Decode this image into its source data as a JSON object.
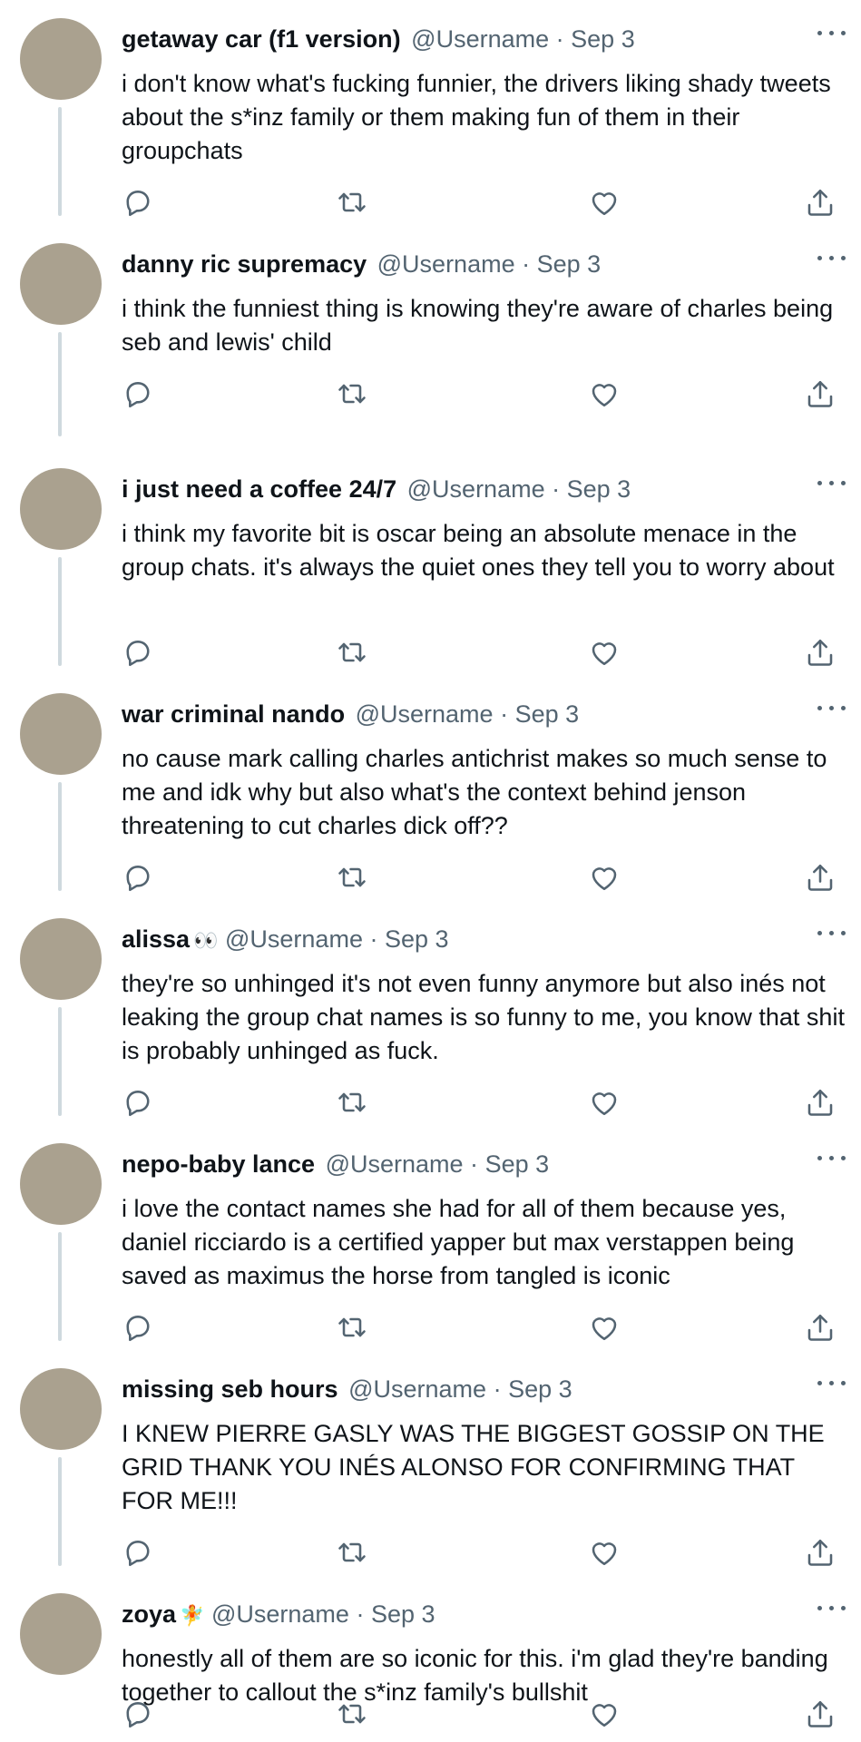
{
  "tweets": [
    {
      "name": "getaway car (f1 version)",
      "emoji": "",
      "handle": "@Username",
      "sep": "·",
      "date": "Sep 3",
      "text": "i don't know what's fucking funnier, the drivers liking shady tweets about the s*inz family or them making fun of them in their groupchats"
    },
    {
      "name": "danny ric supremacy",
      "emoji": "",
      "handle": "@Username",
      "sep": "·",
      "date": "Sep 3",
      "text": "i think the funniest thing is knowing they're aware of charles being seb and lewis' child"
    },
    {
      "name": "i just need a coffee 24/7",
      "emoji": "",
      "handle": "@Username",
      "sep": "·",
      "date": "Sep 3",
      "text": "i think my favorite bit is oscar being an absolute menace in the group chats. it's always the quiet ones they tell you to worry about"
    },
    {
      "name": "war criminal nando",
      "emoji": "",
      "handle": "@Username",
      "sep": "·",
      "date": "Sep 3",
      "text": "no cause mark calling charles antichrist makes so much sense to me and idk why but also what's the context behind jenson threatening to cut charles dick off??"
    },
    {
      "name": "alissa",
      "emoji": "👀",
      "handle": "@Username",
      "sep": "·",
      "date": "Sep 3",
      "text": "they're so unhinged it's not even funny anymore but also inés not leaking the group chat names is so funny to me, you know that shit is probably unhinged as fuck."
    },
    {
      "name": "nepo-baby lance",
      "emoji": "",
      "handle": "@Username",
      "sep": "·",
      "date": "Sep 3",
      "text": "i love the contact names she had for all of them because yes, daniel ricciardo is a certified yapper but max verstappen being saved as maximus the horse from tangled is iconic"
    },
    {
      "name": "missing seb hours",
      "emoji": "",
      "handle": "@Username",
      "sep": "·",
      "date": "Sep 3",
      "text": "I KNEW PIERRE GASLY WAS THE BIGGEST GOSSIP ON THE GRID THANK YOU INÉS ALONSO FOR CONFIRMING THAT FOR ME!!!"
    },
    {
      "name": "zoya",
      "emoji": "🧚",
      "handle": "@Username",
      "sep": "·",
      "date": "Sep 3",
      "text": "honestly all of them are so iconic for this. i'm glad they're banding together to callout the s*inz family's bullshit"
    }
  ],
  "colors": {
    "text": "#0f1419",
    "secondary": "#536471",
    "avatar": "#aaa18f",
    "thread_line": "#cfd9de"
  },
  "icons": {
    "more": "more-icon",
    "reply": "reply-icon",
    "retweet": "retweet-icon",
    "like": "like-icon",
    "share": "share-icon"
  }
}
